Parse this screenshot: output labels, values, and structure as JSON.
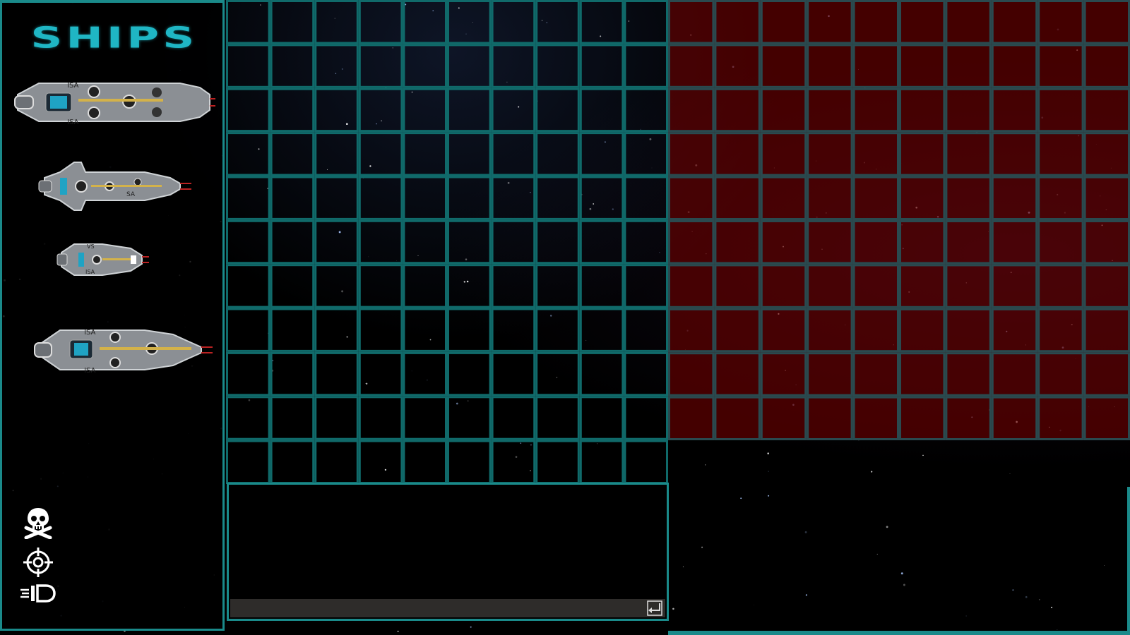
{
  "panel": {
    "title": "SHIPS",
    "ships": [
      {
        "name": "ship-carrier",
        "label_top": "ISA",
        "label_bottom": "ISA"
      },
      {
        "name": "ship-battleship",
        "label_top": "",
        "label_bottom": "SA"
      },
      {
        "name": "ship-destroyer",
        "label_top": "VS",
        "label_bottom": "ISA"
      },
      {
        "name": "ship-cruiser",
        "label_top": "ISA",
        "label_bottom": "ISA"
      }
    ],
    "icons": [
      "skull-crossbones-icon",
      "crosshair-target-icon",
      "fast-forward-ship-icon"
    ]
  },
  "player_board": {
    "rows": 11,
    "cols": 10,
    "line_color": "#106a6a"
  },
  "enemy_board": {
    "rows": 10,
    "cols": 10,
    "line_color": "#2a4a4f",
    "fill_color": "#6e0000"
  },
  "log": {
    "messages": [],
    "input_value": "",
    "input_placeholder": ""
  },
  "colors": {
    "accent": "#1a8a8a",
    "title": "#1fb6c4"
  }
}
